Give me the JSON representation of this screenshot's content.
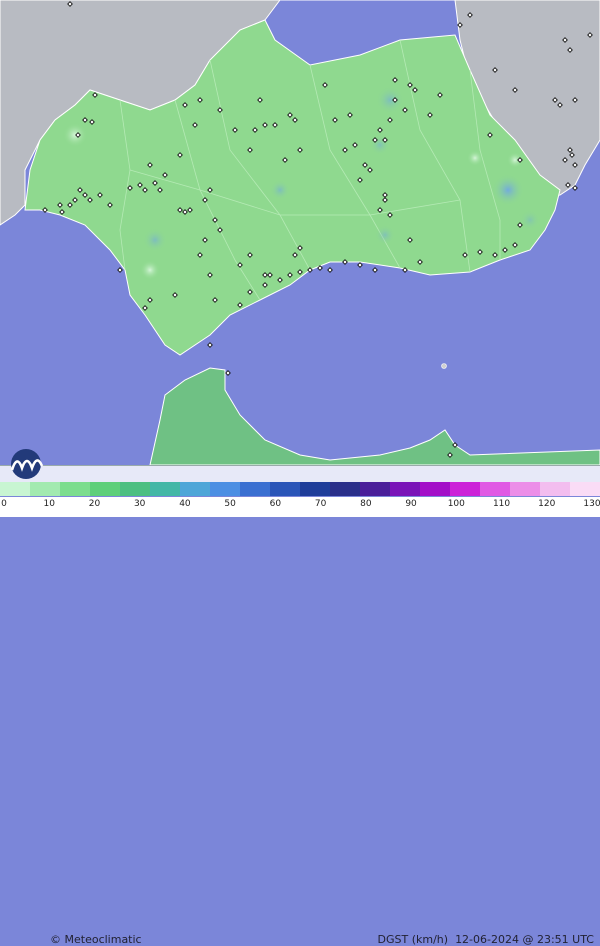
{
  "brand": {
    "name": "Meteoclimatic",
    "symbol": "©"
  },
  "product": {
    "variable": "DGST (km/h)",
    "timestamp": "12-06-2024 @ 23:51 UTC"
  },
  "legend": {
    "ticks": [
      "0",
      "10",
      "20",
      "30",
      "40",
      "50",
      "60",
      "70",
      "80",
      "90",
      "100",
      "110",
      "120",
      "130"
    ],
    "colors": [
      "#c8f5d2",
      "#a2eab0",
      "#7cdd8e",
      "#5ecf7a",
      "#4cbf82",
      "#43b7a6",
      "#4ea6d8",
      "#4c8fe3",
      "#3a6fd1",
      "#2a55b8",
      "#1e3d9a",
      "#2a2f8a",
      "#4a1e9a",
      "#7a14b8",
      "#a30fc8",
      "#cc22d8",
      "#e05ae4",
      "#ec8ee8",
      "#f3bdef",
      "#fadcf6"
    ]
  },
  "colors": {
    "sea": "#7b86d9",
    "land_andalucia": "#8fd98f",
    "land_other": "#b9bcc3",
    "africa": "#6fc184"
  }
}
